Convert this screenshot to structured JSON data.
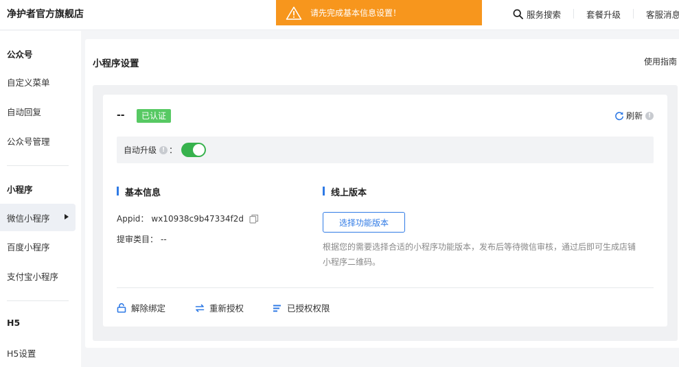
{
  "header": {
    "store_name": "净护者官方旗舰店",
    "alert": "请先完成基本信息设置！",
    "actions": {
      "service_search": "服务搜索",
      "package_upgrade": "套餐升级",
      "customer_message": "客服消息"
    }
  },
  "sidebar": {
    "group_official": "公众号",
    "items_official": [
      "自定义菜单",
      "自动回复",
      "公众号管理"
    ],
    "group_mini": "小程序",
    "items_mini": [
      "微信小程序",
      "百度小程序",
      "支付宝小程序"
    ],
    "active_item": "微信小程序",
    "group_h5": "H5",
    "items_h5": [
      "H5设置"
    ]
  },
  "main": {
    "title": "小程序设置",
    "guide_link": "使用指南",
    "app_name": "--",
    "verified_badge": "已认证",
    "refresh_label": "刷新",
    "auto_upgrade_label": "自动升级",
    "auto_upgrade_colon": "：",
    "auto_upgrade_on": true,
    "basic_info_title": "基本信息",
    "appid_label": "Appid：",
    "appid_value": "wx10938c9b47334f2d",
    "category_label": "提审类目：",
    "category_value": "--",
    "online_version_title": "线上版本",
    "select_version_button": "选择功能版本",
    "description": "根据您的需要选择合适的小程序功能版本，发布后等待微信审核，通过后即可生成店铺小程序二维码。",
    "actions": {
      "unbind": "解除绑定",
      "reauthorize": "重新授权",
      "authorized_permissions": "已授权权限"
    }
  },
  "colors": {
    "accent": "#2f7ae5",
    "alert_bg": "#f7961d",
    "verified_bg": "#57c963",
    "toggle_on": "#37b24d"
  }
}
